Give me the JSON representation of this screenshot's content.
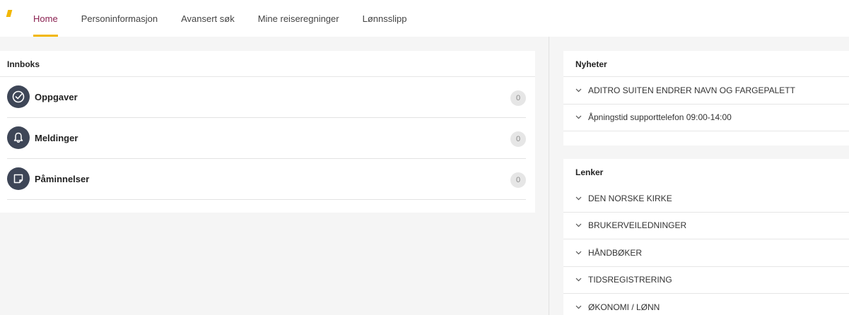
{
  "nav": {
    "items": [
      {
        "label": "Home",
        "active": true
      },
      {
        "label": "Personinformasjon",
        "active": false
      },
      {
        "label": "Avansert søk",
        "active": false
      },
      {
        "label": "Mine reiseregninger",
        "active": false
      },
      {
        "label": "Lønnsslipp",
        "active": false
      }
    ]
  },
  "colors": {
    "accent": "#f2b705",
    "active_nav": "#8a2050",
    "icon_bg": "#3e4657",
    "page_bg": "#f5f5f5"
  },
  "inbox": {
    "title": "Innboks",
    "rows": [
      {
        "label": "Oppgaver",
        "count": "0",
        "icon": "check-circle-icon"
      },
      {
        "label": "Meldinger",
        "count": "0",
        "icon": "bell-icon"
      },
      {
        "label": "Påminnelser",
        "count": "0",
        "icon": "sticky-note-icon"
      }
    ]
  },
  "news": {
    "title": "Nyheter",
    "items": [
      {
        "label": "ADITRO SUITEN ENDRER NAVN OG FARGEPALETT"
      },
      {
        "label": "Åpningstid supporttelefon 09:00-14:00"
      }
    ]
  },
  "links": {
    "title": "Lenker",
    "items": [
      {
        "label": "DEN NORSKE KIRKE"
      },
      {
        "label": "BRUKERVEILEDNINGER"
      },
      {
        "label": "HÅNDBØKER"
      },
      {
        "label": "TIDSREGISTRERING"
      },
      {
        "label": "ØKONOMI / LØNN"
      }
    ]
  }
}
